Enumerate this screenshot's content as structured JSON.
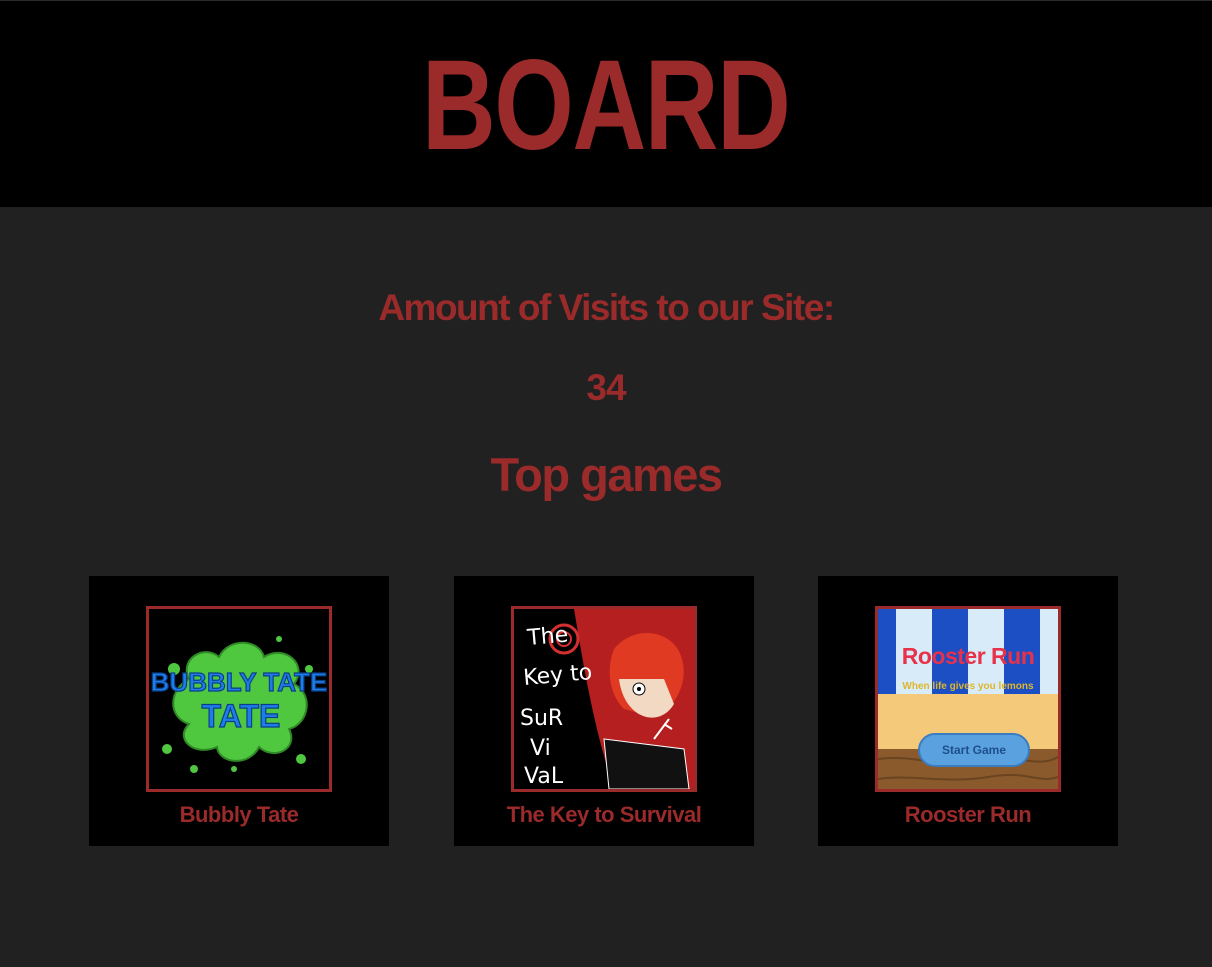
{
  "header": {
    "logo_text": "BOARD"
  },
  "stats": {
    "visits_label": "Amount of Visits to our Site:",
    "visits_count": "34"
  },
  "games_section": {
    "heading": "Top games",
    "games": [
      {
        "name": "Bubbly Tate",
        "art_text": "BUBBLY TATE"
      },
      {
        "name": "The Key to Survival",
        "art_text": "The Key to SurViVaL"
      },
      {
        "name": "Rooster Run",
        "art_title": "Rooster Run",
        "art_subtitle": "When life gives you lemons",
        "art_button": "Start Game"
      }
    ]
  },
  "colors": {
    "accent": "#9b2a2a",
    "page_bg": "#212121",
    "header_bg": "#000000",
    "card_bg": "#000000"
  }
}
